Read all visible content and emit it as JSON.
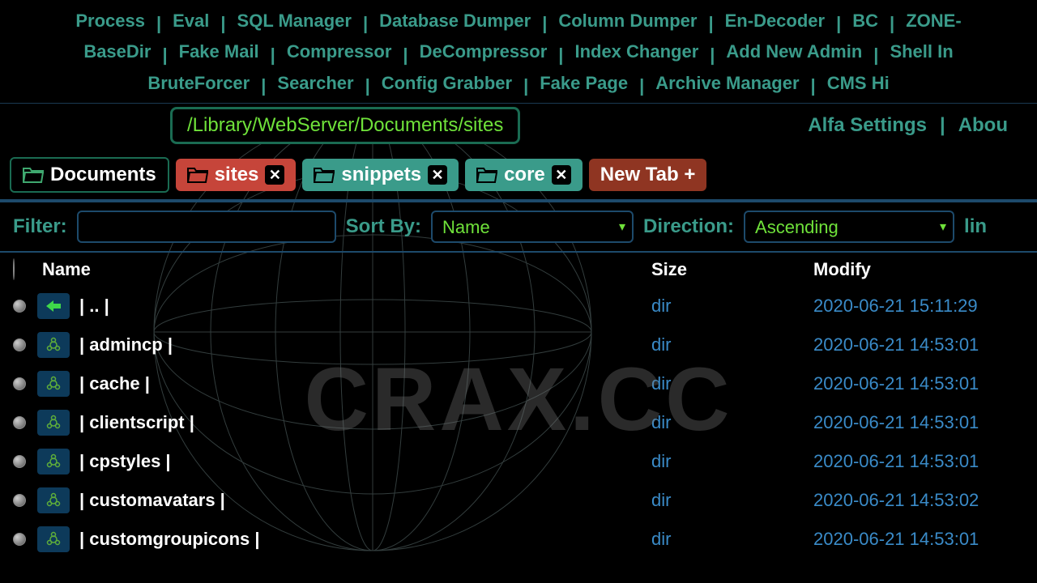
{
  "nav": {
    "row1": [
      "Process",
      "Eval",
      "SQL Manager",
      "Database Dumper",
      "Column Dumper",
      "En-Decoder",
      "BC",
      "ZONE-"
    ],
    "row2": [
      "BaseDir",
      "Fake Mail",
      "Compressor",
      "DeCompressor",
      "Index Changer",
      "Add New Admin",
      "Shell In"
    ],
    "row3": [
      "BruteForcer",
      "Searcher",
      "Config Grabber",
      "Fake Page",
      "Archive Manager",
      "CMS Hi"
    ]
  },
  "path": "/Library/WebServer/Documents/sites",
  "settings": {
    "label": "Alfa Settings",
    "about": "Abou"
  },
  "tabs": {
    "active": "Documents",
    "sites": "sites",
    "snippets": "snippets",
    "core": "core",
    "newtab": "New Tab +"
  },
  "filter": {
    "label": "Filter:",
    "sortby_label": "Sort By:",
    "sortby_value": "Name",
    "direction_label": "Direction:",
    "direction_value": "Ascending",
    "tail": "lin"
  },
  "columns": {
    "name": "Name",
    "size": "Size",
    "modify": "Modify"
  },
  "rows": [
    {
      "name": "| .. |",
      "size": "dir",
      "modify": "2020-06-21 15:11:29",
      "up": true
    },
    {
      "name": "| admincp |",
      "size": "dir",
      "modify": "2020-06-21 14:53:01"
    },
    {
      "name": "| cache |",
      "size": "dir",
      "modify": "2020-06-21 14:53:01"
    },
    {
      "name": "| clientscript |",
      "size": "dir",
      "modify": "2020-06-21 14:53:01"
    },
    {
      "name": "| cpstyles |",
      "size": "dir",
      "modify": "2020-06-21 14:53:01"
    },
    {
      "name": "| customavatars |",
      "size": "dir",
      "modify": "2020-06-21 14:53:02"
    },
    {
      "name": "| customgroupicons |",
      "size": "dir",
      "modify": "2020-06-21 14:53:01"
    }
  ],
  "watermark": "CRAX.CC"
}
